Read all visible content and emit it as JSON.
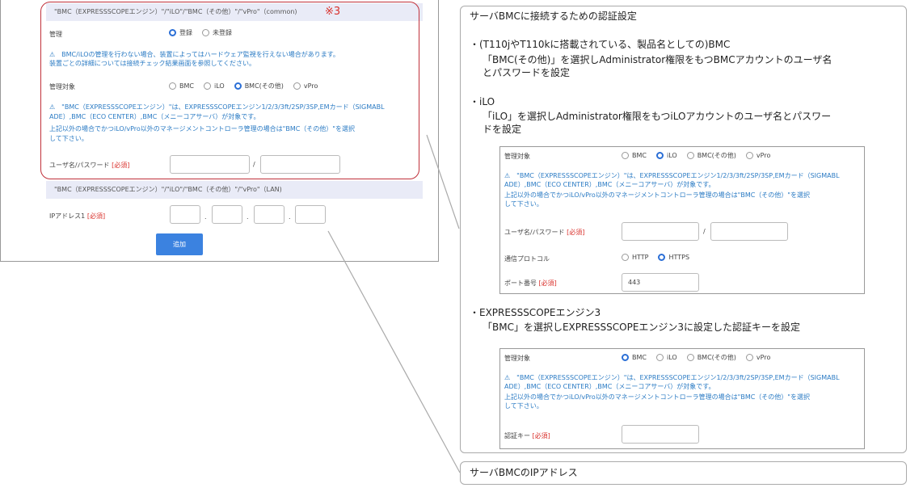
{
  "form": {
    "section_common_header": "\"BMC（EXPRESSSCOPEエンジン）\"/\"iLO\"/\"BMC（その他）\"/\"vPro\"（common)",
    "marker": "※3",
    "management_label": "管理",
    "management_options": [
      "登録",
      "未登録"
    ],
    "management_warning_line1": "⚠　BMC/iLOの管理を行わない場合、装置によってはハードウェア監視を行えない場合があります。",
    "management_warning_line2": "装置ごとの詳細については接続チェック結果画面を参照してください。",
    "target_label": "管理対象",
    "target_options": [
      "BMC",
      "iLO",
      "BMC(その他)",
      "vPro"
    ],
    "target_note_line1": "⚠　\"BMC（EXPRESSSCOPEエンジン）\"は、EXPRESSSCOPEエンジン1/2/3/3ft/2SP/3SP,EMカード（SIGMABL",
    "target_note_line2": "ADE）,BMC（ECO CENTER）,BMC（メニーコアサーバ）が対象です。",
    "target_note_line3": "上記以外の場合でかつiLO/vPro以外のマネージメントコントローラ管理の場合は\"BMC（その他）\"を選択",
    "target_note_line4": "して下さい。",
    "userpass_label": "ユーザ名/パスワード",
    "required": "[必須]",
    "slash": "/",
    "section_lan_header": "\"BMC（EXPRESSSCOPEエンジン）\"/\"iLO\"/\"BMC（その他）\"/\"vPro\"（LAN)",
    "ip_label": "IPアドレス1",
    "dot": ".",
    "add_button": "追加"
  },
  "auth_callout": {
    "title": "サーバBMCに接続するための認証設定",
    "bmc_heading": "・(T110jやT110kに搭載されている、製品名としての)BMC",
    "bmc_desc_line1": "「BMC(その他)」を選択しAdministrator権限をもつBMCアカウントのユーザ名",
    "bmc_desc_line2": "とパスワードを設定",
    "ilo_heading": "・iLO",
    "ilo_desc_line1": "「iLO」を選択しAdministrator権限をもつiLOアカウントのユーザ名とパスワー",
    "ilo_desc_line2": "ドを設定",
    "ilo_panel": {
      "target_label": "管理対象",
      "target_options": [
        "BMC",
        "iLO",
        "BMC(その他)",
        "vPro"
      ],
      "note_line1": "⚠　\"BMC（EXPRESSSCOPEエンジン）\"は、EXPRESSSCOPEエンジン1/2/3/3ft/2SP/3SP,EMカード（SIGMABL",
      "note_line2": "ADE）,BMC（ECO CENTER）,BMC（メニーコアサーバ）が対象です。",
      "note_line3": "上記以外の場合でかつiLO/vPro以外のマネージメントコントローラ管理の場合は\"BMC（その他）\"を選択",
      "note_line4": "して下さい。",
      "userpass_label": "ユーザ名/パスワード",
      "required": "[必須]",
      "slash": "/",
      "protocol_label": "通信プロトコル",
      "protocol_options": [
        "HTTP",
        "HTTPS"
      ],
      "port_label": "ポート番号",
      "port_value": "443"
    },
    "exp_heading": "・EXPRESSSCOPEエンジン3",
    "exp_desc": "「BMC」を選択しEXPRESSSCOPEエンジン3に設定した認証キーを設定",
    "exp_panel": {
      "target_label": "管理対象",
      "target_options": [
        "BMC",
        "iLO",
        "BMC(その他)",
        "vPro"
      ],
      "note_line1": "⚠　\"BMC（EXPRESSSCOPEエンジン）\"は、EXPRESSSCOPEエンジン1/2/3/3ft/2SP/3SP,EMカード（SIGMABL",
      "note_line2": "ADE）,BMC（ECO CENTER）,BMC（メニーコアサーバ）が対象です。",
      "note_line3": "上記以外の場合でかつiLO/vPro以外のマネージメントコントローラ管理の場合は\"BMC（その他）\"を選択",
      "note_line4": "して下さい。",
      "authkey_label": "認証キー",
      "required": "[必須]"
    }
  },
  "ip_callout": {
    "title": "サーバBMCのIPアドレス"
  },
  "colors": {
    "accent_blue": "#3b82e0",
    "required_red": "#d9302b",
    "note_blue": "#2b7bc4",
    "highlight_border": "#c0303a"
  }
}
